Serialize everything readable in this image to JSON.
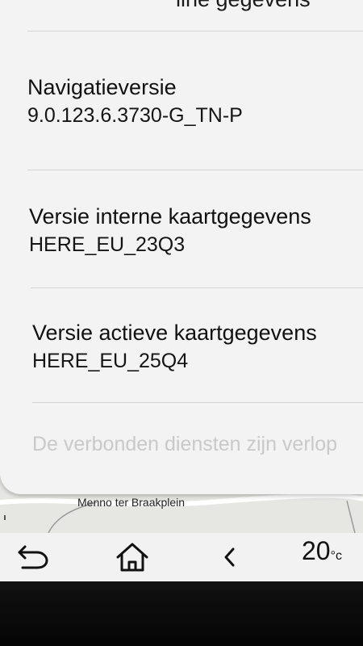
{
  "header": {
    "partial_title": "line gegevens"
  },
  "info": [
    {
      "title": "Navigatieversie",
      "value": "9.0.123.6.3730-G_TN-P"
    },
    {
      "title": "Versie interne kaartgegevens",
      "value": "HERE_EU_23Q3"
    },
    {
      "title": "Versie actieve kaartgegevens",
      "value": "HERE_EU_25Q4"
    }
  ],
  "faded_text": "De verbonden diensten zijn verlop",
  "map": {
    "street_label": "Menno ter Braakplein"
  },
  "navbar": {
    "back_icon": "back-arrow-icon",
    "home_icon": "home-icon",
    "prev_icon": "chevron-left-icon",
    "temperature_value": "20",
    "temperature_unit": "°c"
  },
  "colors": {
    "panel": "#f3f3f3",
    "divider": "#d4d4d4",
    "bezel": "#0c0c0c"
  }
}
